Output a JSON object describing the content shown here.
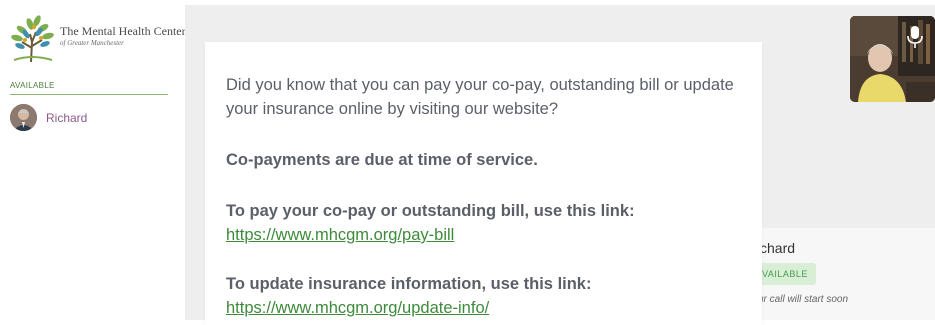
{
  "sidebar": {
    "logo": {
      "title": "The Mental Health Center",
      "subtitle": "of Greater Manchester"
    },
    "section_label": "AVAILABLE",
    "users": [
      {
        "name": "Richard"
      }
    ]
  },
  "participant": {
    "name": "chard",
    "badge": "VAILABLE",
    "status": "ur call will start soon"
  },
  "message": {
    "intro": "Did you know that you can pay your co-pay, outstanding bill or update your insurance online by visiting our website?",
    "copay_due": "Co-payments are due at time of service.",
    "pay_label": "To pay your co-pay or outstanding bill, use this link:",
    "pay_link": "https://www.mhcgm.org/pay-bill",
    "update_label": "To update insurance information, use this link:",
    "update_link": "https://www.mhcgm.org/update-info/"
  },
  "colors": {
    "accent_green": "#3d8a3b",
    "badge_bg": "#d8efd6",
    "user_name": "#8a5a8a"
  },
  "icons": {
    "logo": "tree-logo-icon",
    "mic": "microphone-icon"
  }
}
